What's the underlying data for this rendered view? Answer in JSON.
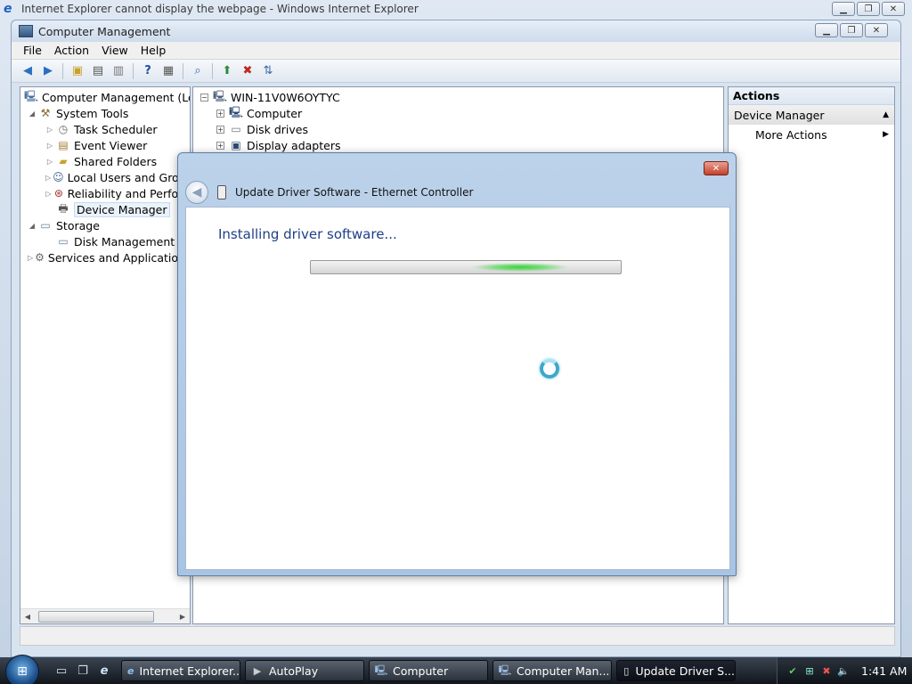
{
  "ie_window": {
    "title": "Internet Explorer cannot display the webpage - Windows Internet Explorer"
  },
  "cm_window": {
    "title": "Computer Management",
    "menu": [
      "File",
      "Action",
      "View",
      "Help"
    ],
    "tree": {
      "root": "Computer Management (Local",
      "items": [
        {
          "label": "System Tools",
          "level": 1,
          "icon": "tools-icon"
        },
        {
          "label": "Task Scheduler",
          "level": 2,
          "icon": "clock-icon"
        },
        {
          "label": "Event Viewer",
          "level": 2,
          "icon": "event-viewer-icon"
        },
        {
          "label": "Shared Folders",
          "level": 2,
          "icon": "shared-folders-icon"
        },
        {
          "label": "Local Users and Group",
          "level": 2,
          "icon": "users-icon"
        },
        {
          "label": "Reliability and Perforn",
          "level": 2,
          "icon": "reliability-icon"
        },
        {
          "label": "Device Manager",
          "level": 2,
          "icon": "device-manager-icon"
        },
        {
          "label": "Storage",
          "level": 1,
          "icon": "storage-icon"
        },
        {
          "label": "Disk Management",
          "level": 2,
          "icon": "disk-management-icon"
        },
        {
          "label": "Services and Applications",
          "level": 1,
          "icon": "services-icon"
        }
      ]
    },
    "devices": {
      "root": "WIN-11V0W6OYTYC",
      "items": [
        "Computer",
        "Disk drives",
        "Display adapters"
      ]
    },
    "actions": {
      "header": "Actions",
      "section": "Device Manager",
      "more": "More Actions"
    }
  },
  "dialog": {
    "title": "Update Driver Software - Ethernet Controller",
    "status": "Installing driver software...",
    "close_label": "✕"
  },
  "taskbar": {
    "buttons": [
      {
        "label": "Internet Explorer...",
        "icon": "ie-icon"
      },
      {
        "label": "AutoPlay",
        "icon": "autoplay-icon"
      },
      {
        "label": "Computer",
        "icon": "computer-icon"
      },
      {
        "label": "Computer Man...",
        "icon": "computer-management-icon"
      },
      {
        "label": "Update Driver S...",
        "icon": "driver-icon"
      }
    ],
    "clock": "1:41 AM"
  }
}
